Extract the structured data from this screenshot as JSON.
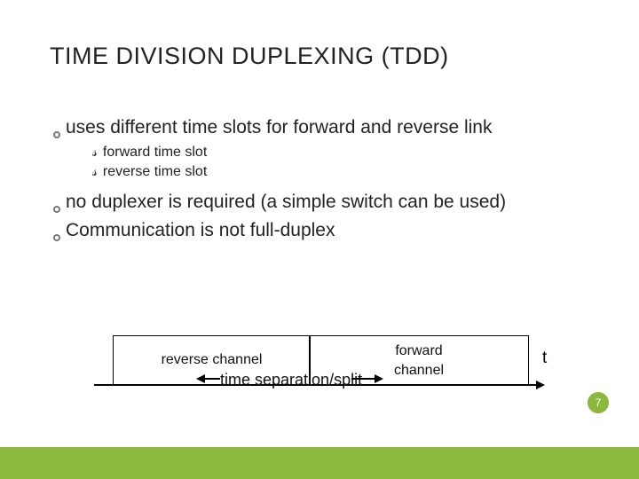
{
  "title_small": "T",
  "title_rest": "IME DIVISION DUPLEXING",
  "title_paren": "(TDD)",
  "bullets": {
    "b1": "uses different time slots for forward and reverse link",
    "s1": "forward time slot",
    "s2": "reverse time slot",
    "b2": "no duplexer is required (a simple switch can be used)",
    "b3": "Communication is not full-duplex"
  },
  "diagram": {
    "rev": "reverse channel",
    "fwd1": "forward",
    "fwd2": "channel",
    "sep": "time separation/split",
    "t": "t"
  },
  "page": "7"
}
